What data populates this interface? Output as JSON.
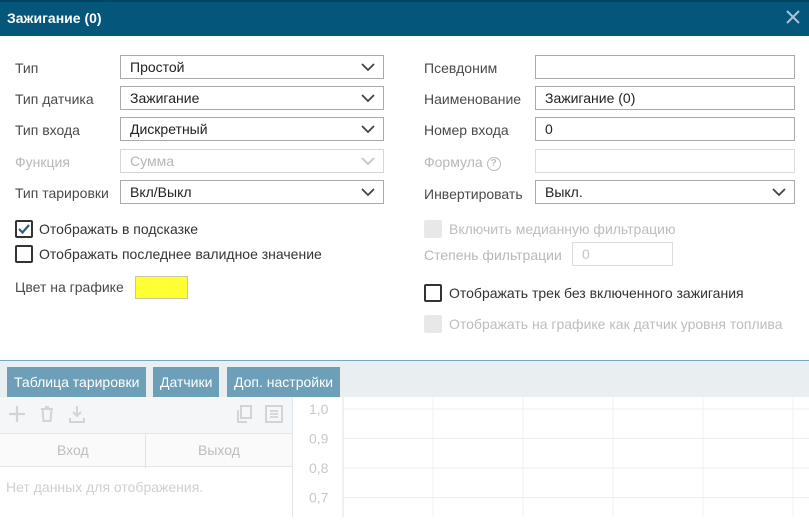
{
  "dialog": {
    "title": "Зажигание (0)"
  },
  "left": {
    "type": {
      "label": "Тип",
      "value": "Простой"
    },
    "sensor_type": {
      "label": "Тип датчика",
      "value": "Зажигание"
    },
    "input_type": {
      "label": "Тип входа",
      "value": "Дискретный"
    },
    "function": {
      "label": "Функция",
      "value": "Сумма"
    },
    "calibration_type": {
      "label": "Тип тарировки",
      "value": "Вкл/Выкл"
    },
    "show_tooltip": {
      "label": "Отображать в подсказке",
      "checked": true
    },
    "show_last_valid": {
      "label": "Отображать последнее валидное значение",
      "checked": false
    },
    "chart_color": {
      "label": "Цвет на графике",
      "value": "#ffff33"
    }
  },
  "right": {
    "alias": {
      "label": "Псевдоним",
      "value": ""
    },
    "name": {
      "label": "Наименование",
      "value": "Зажигание (0)"
    },
    "input_number": {
      "label": "Номер входа",
      "value": "0"
    },
    "formula": {
      "label": "Формула",
      "value": ""
    },
    "invert": {
      "label": "Инвертировать",
      "value": "Выкл."
    },
    "median_filter": {
      "label": "Включить медианную фильтрацию",
      "checked": false
    },
    "filter_degree": {
      "label": "Степень фильтрации",
      "placeholder": "0"
    },
    "show_track": {
      "label": "Отображать трек без включенного зажигания",
      "checked": false
    },
    "fuel_level_chart": {
      "label": "Отображать на графике как датчик уровня топлива",
      "checked": false
    }
  },
  "tabs": [
    {
      "label": "Таблица тарировки"
    },
    {
      "label": "Датчики"
    },
    {
      "label": "Доп. настройки"
    }
  ],
  "table": {
    "columns": [
      "Вход",
      "Выход"
    ],
    "empty_text": "Нет данных для отображения."
  },
  "chart_data": {
    "type": "line",
    "y_ticks": [
      "1,0",
      "0,9",
      "0,8",
      "0,7"
    ],
    "series": []
  },
  "colors": {
    "titlebar": "#04567a",
    "tab": "#6d9fb8",
    "swatch": "#ffff33"
  }
}
